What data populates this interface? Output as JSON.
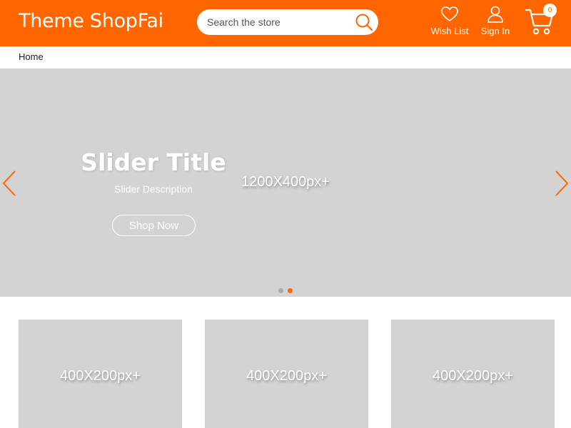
{
  "header": {
    "logo": "Theme ShopFai",
    "search": {
      "placeholder": "Search the store",
      "value": ""
    },
    "wish_list_label": "Wish List",
    "sign_in_label": "Sign In",
    "cart_count": "0",
    "colors": {
      "background": "#ff6600",
      "text": "#ffffff"
    }
  },
  "breadcrumb": {
    "home": "Home"
  },
  "hero": {
    "title": "Slider Title",
    "description": "Slider Description",
    "button_label": "Shop Now",
    "image_size_text": "1200X400px+",
    "placeholder_color": "#d3d3d3",
    "prev_icon": "chevron-left-icon",
    "next_icon": "chevron-right-icon",
    "dots": [
      {
        "active": false,
        "color": "#aaaaaa"
      },
      {
        "active": true,
        "color": "#ff6600"
      }
    ]
  },
  "banners": [
    {
      "size_text": "400X200px+"
    },
    {
      "size_text": "400X200px+"
    },
    {
      "size_text": "400X200px+"
    }
  ]
}
